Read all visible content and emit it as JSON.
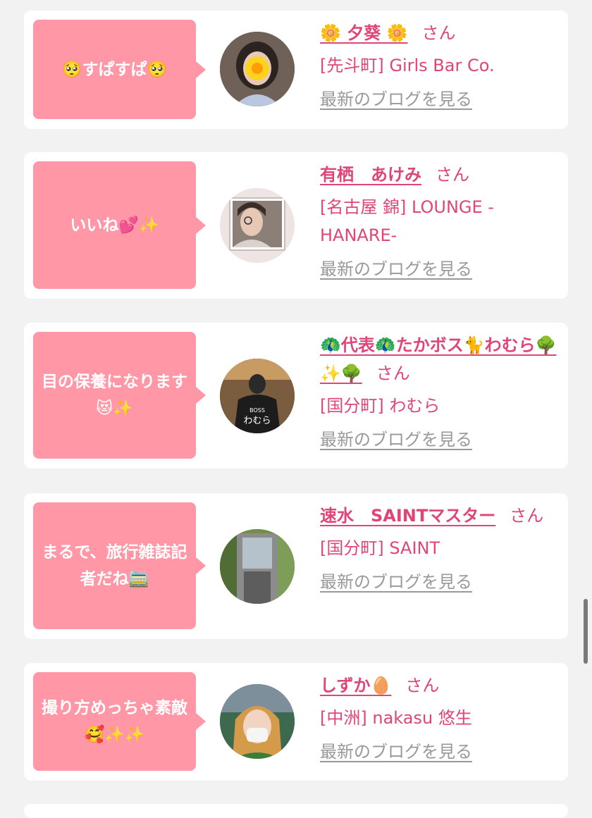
{
  "cards": [
    {
      "comment": "🥺すぱすぱ🥺",
      "name": "🌼 夕葵 🌼",
      "san": "さん",
      "shop": "[先斗町] Girls Bar Co.",
      "blog": "最新のブログを見る"
    },
    {
      "comment": "いいね💕✨",
      "name": "有栖　あけみ",
      "san": "さん",
      "shop": "[名古屋 錦] LOUNGE -HANARE-",
      "blog": "最新のブログを見る"
    },
    {
      "comment": "目の保養になります😻✨",
      "name": "🦚代表🦚たかボス🐈わむら🌳✨🌳",
      "san": "さん",
      "shop": "[国分町] わむら",
      "blog": "最新のブログを見る"
    },
    {
      "comment": "まるで、旅行雑誌記者だね🚞",
      "name": "速水　SAINTマスター",
      "san": "さん",
      "shop": "[国分町] SAINT",
      "blog": "最新のブログを見る"
    },
    {
      "comment": "撮り方めっちゃ素敵🥰✨✨",
      "name": "しずか🥚",
      "san": "さん",
      "shop": "[中洲] nakasu 悠生",
      "blog": "最新のブログを見る"
    }
  ],
  "avatar_icon": "🌼",
  "avatar_text": "わむら"
}
